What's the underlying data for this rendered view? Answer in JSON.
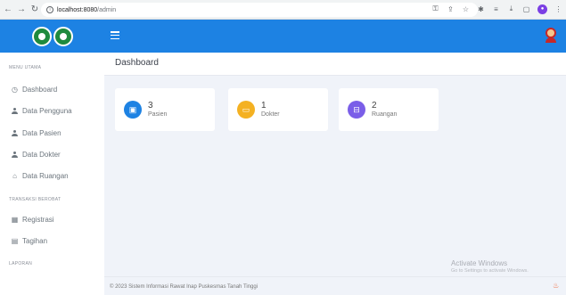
{
  "browser": {
    "url_host": "localhost:8080",
    "url_path": "/admin"
  },
  "sidebar": {
    "section_main": "MENU UTAMA",
    "items_main": [
      {
        "label": "Dashboard",
        "icon": "dashboard-icon"
      },
      {
        "label": "Data Pengguna",
        "icon": "user-icon"
      },
      {
        "label": "Data Pasien",
        "icon": "user-icon"
      },
      {
        "label": "Data Dokter",
        "icon": "user-icon"
      },
      {
        "label": "Data Ruangan",
        "icon": "home-icon"
      }
    ],
    "section_transaksi": "TRANSAKSI BEROBAT",
    "items_transaksi": [
      {
        "label": "Registrasi",
        "icon": "calendar-icon"
      },
      {
        "label": "Tagihan",
        "icon": "invoice-icon"
      }
    ],
    "section_laporan": "LAPORAN"
  },
  "header": {
    "title": "Dashboard"
  },
  "cards": [
    {
      "value": "3",
      "label": "Pasien",
      "color": "#1d82e3",
      "icon": "wallet-icon"
    },
    {
      "value": "1",
      "label": "Dokter",
      "color": "#f4b122",
      "icon": "laptop-icon"
    },
    {
      "value": "2",
      "label": "Ruangan",
      "color": "#7a5ee8",
      "icon": "cart-icon"
    }
  ],
  "footer": {
    "text": "© 2023 Sistem Informasi Rawat Inap Puskesmas Tanah Tinggi"
  },
  "watermark": {
    "title": "Activate Windows",
    "subtitle": "Go to Settings to activate Windows."
  },
  "colors": {
    "primary": "#1d82e3",
    "background": "#f0f3f9"
  }
}
